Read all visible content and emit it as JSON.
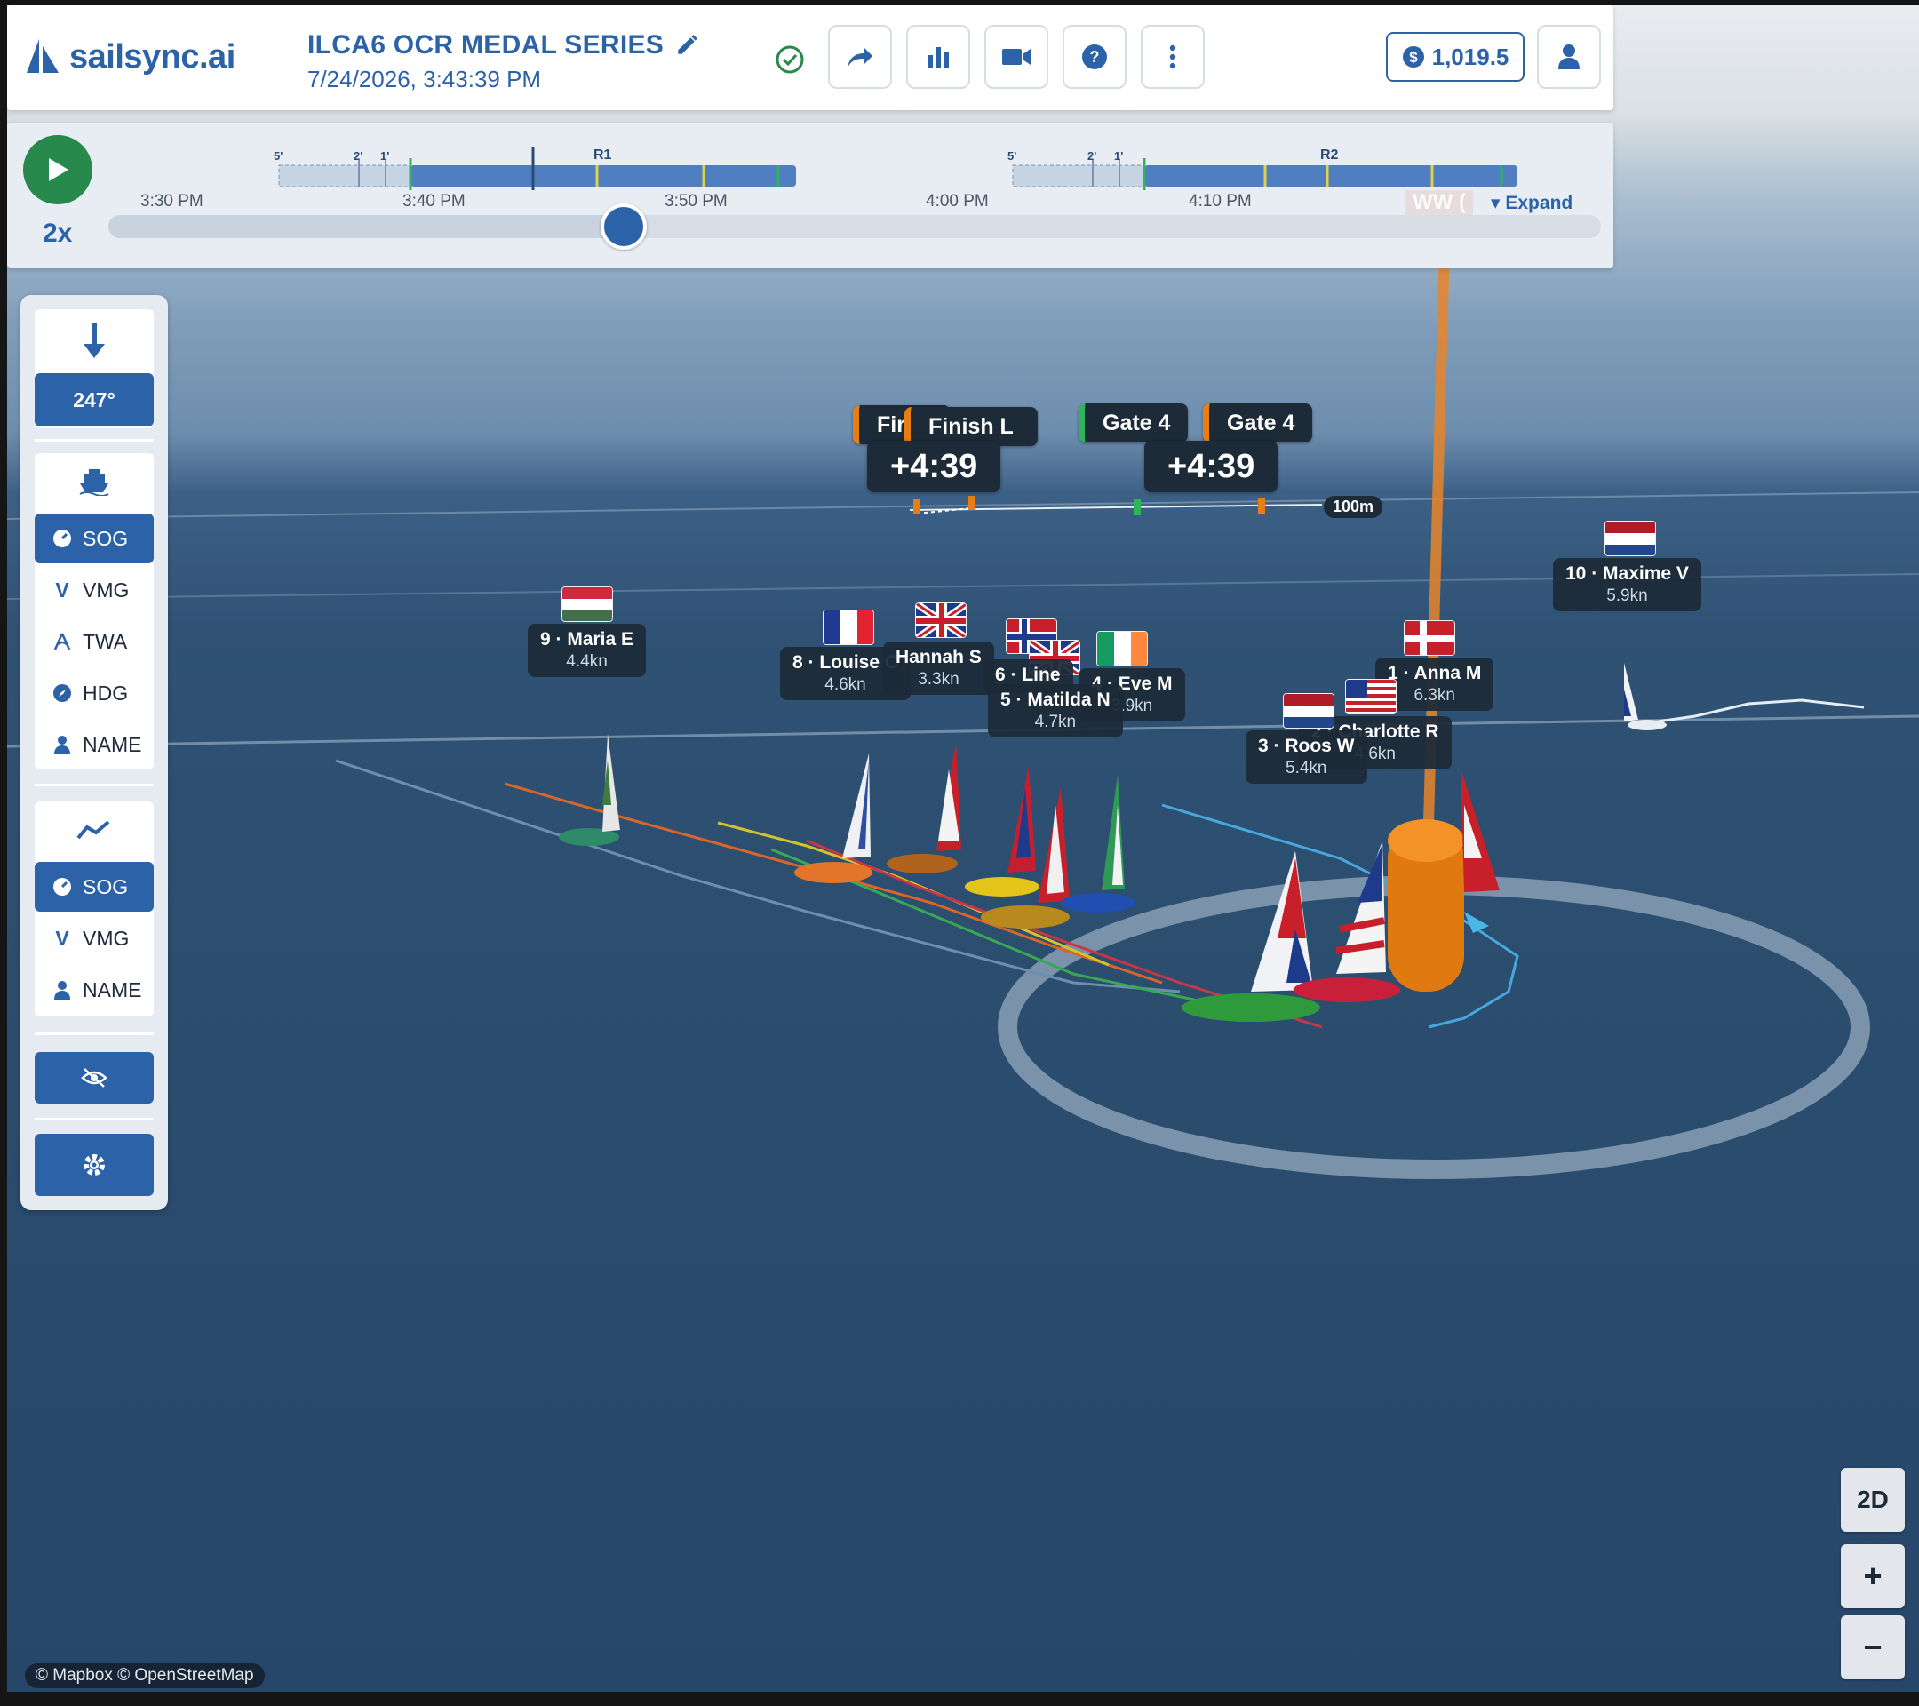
{
  "app": {
    "brand": "sailsync.ai"
  },
  "header": {
    "title": "ILCA6 OCR MEDAL SERIES",
    "datetime": "7/24/2026, 3:43:39 PM",
    "credits": "1,019.5"
  },
  "timeline": {
    "speed": "2x",
    "ticks": [
      "3:30 PM",
      "3:40 PM",
      "3:50 PM",
      "4:00 PM",
      "4:10 PM"
    ],
    "races": [
      {
        "label": "R1",
        "pre": [
          "5'",
          "2'",
          "1'"
        ]
      },
      {
        "label": "R2",
        "pre": [
          "5'",
          "2'",
          "1'"
        ]
      }
    ],
    "playhead_fraction": 0.345,
    "ww_label": "WW (",
    "expand_label": "▾ Expand"
  },
  "left_panel": {
    "wind_direction": "247°",
    "label_options": [
      {
        "icon": "gauge-icon",
        "label": "SOG",
        "active": true
      },
      {
        "icon": "v-icon",
        "label": "VMG",
        "active": false
      },
      {
        "icon": "angle-icon",
        "label": "TWA",
        "active": false
      },
      {
        "icon": "compass-icon",
        "label": "HDG",
        "active": false
      },
      {
        "icon": "person-icon",
        "label": "NAME",
        "active": false
      }
    ],
    "track_options": [
      {
        "icon": "gauge-icon",
        "label": "SOG",
        "active": true
      },
      {
        "icon": "v-icon",
        "label": "VMG",
        "active": false
      },
      {
        "icon": "person-icon",
        "label": "NAME",
        "active": false
      }
    ]
  },
  "marks": {
    "finish_a": "Fir",
    "finish_b": "Finish L",
    "gate_a": "Gate 4",
    "gate_b": "Gate 4",
    "delta_a": "+4:39",
    "delta_b": "+4:39",
    "scale": "100m"
  },
  "boats": [
    {
      "name": "9 · Maria E",
      "speed": "4.4kn",
      "flag": "HUN"
    },
    {
      "name": "8 · Louise C",
      "speed": "4.6kn",
      "flag": "FRA"
    },
    {
      "name": "Hannah S",
      "speed": "3.3kn",
      "flag": "GBR"
    },
    {
      "name": "6 · Line",
      "speed": "",
      "flag": "NOR"
    },
    {
      "name": "5 · Matilda N",
      "speed": "4.7kn",
      "flag": "GBR"
    },
    {
      "name": "4 · Eve M",
      "speed": "3.9kn",
      "flag": "IRL"
    },
    {
      "name": "1 · Anna M",
      "speed": "6.3kn",
      "flag": "DEN"
    },
    {
      "name": "2 · Charlotte R",
      "speed": "4.6kn",
      "flag": "USA"
    },
    {
      "name": "3 · Roos W",
      "speed": "5.4kn",
      "flag": "NED"
    },
    {
      "name": "10 · Maxime V",
      "speed": "5.9kn",
      "flag": "NED"
    }
  ],
  "map_controls": {
    "view_toggle": "2D",
    "zoom_in": "+",
    "zoom_out": "−"
  },
  "attribution": "© Mapbox © OpenStreetMap",
  "colors": {
    "brand": "#2c63a8",
    "play": "#27894b",
    "mark_orange": "#e87e12",
    "mark_green": "#2fb45a",
    "water": "#2b4d6e"
  }
}
